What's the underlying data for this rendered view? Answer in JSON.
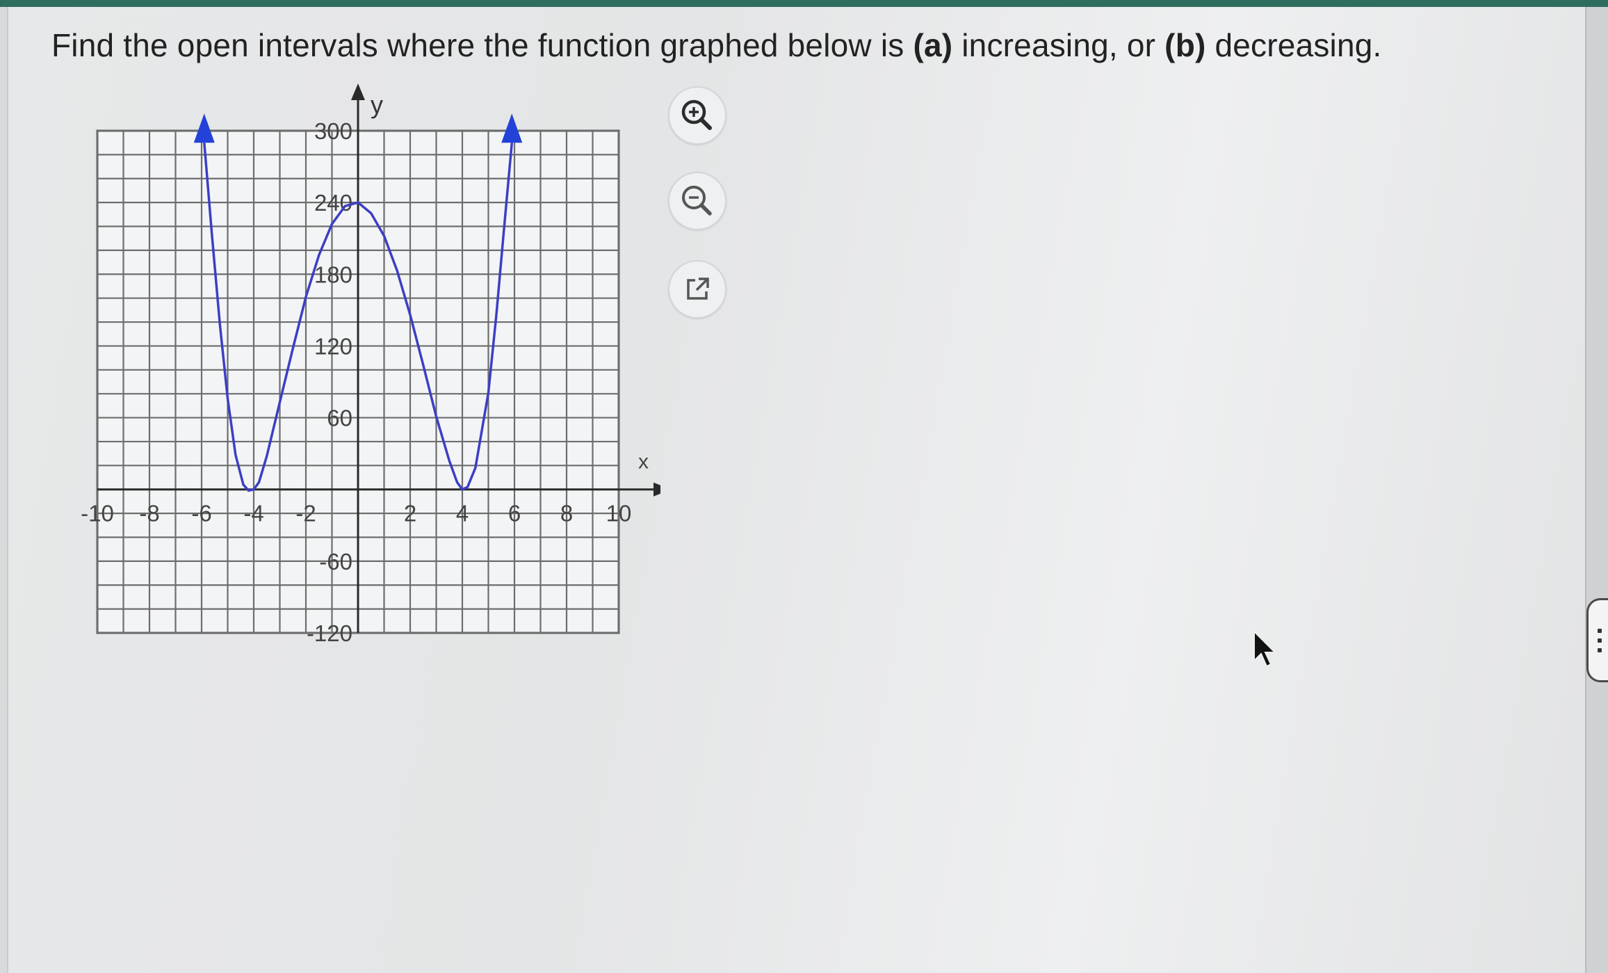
{
  "question": {
    "prefix": "Find the open intervals where the function graphed below is ",
    "part_a": "(a)",
    "mid": " increasing, or ",
    "part_b": "(b)",
    "suffix": " decreasing."
  },
  "toolbar": {
    "zoom_in_icon": "zoom-in-icon",
    "zoom_out_icon": "zoom-out-icon",
    "popout_icon": "external-link-icon"
  },
  "chart_data": {
    "type": "line",
    "xlabel": "x",
    "ylabel": "y",
    "xlim": [
      -10,
      10
    ],
    "ylim": [
      -120,
      300
    ],
    "grid": true,
    "x_ticks": [
      "-10",
      "-8",
      "-6",
      "-4",
      "-2",
      "2",
      "4",
      "6",
      "8",
      "10"
    ],
    "x_tick_values": [
      -10,
      -8,
      -6,
      -4,
      -2,
      2,
      4,
      6,
      8,
      10
    ],
    "y_ticks": [
      "300",
      "240",
      "180",
      "120",
      "60",
      "-60",
      "-120"
    ],
    "y_tick_values": [
      300,
      240,
      180,
      120,
      60,
      -60,
      -120
    ],
    "series": [
      {
        "color": "#3b3fc4",
        "arrow_color": "#2342d8",
        "end_arrows": true,
        "points": [
          [
            -5.9,
            290
          ],
          [
            -5.6,
            212
          ],
          [
            -5.3,
            138
          ],
          [
            -5,
            76
          ],
          [
            -4.7,
            29
          ],
          [
            -4.4,
            4
          ],
          [
            -4.2,
            -1
          ],
          [
            -4,
            0
          ],
          [
            -3.8,
            6
          ],
          [
            -3.5,
            28
          ],
          [
            -3,
            73
          ],
          [
            -2.5,
            118
          ],
          [
            -2,
            161
          ],
          [
            -1.5,
            196
          ],
          [
            -1,
            222
          ],
          [
            -0.5,
            237
          ],
          [
            0,
            240
          ],
          [
            0.5,
            231
          ],
          [
            1,
            212
          ],
          [
            1.5,
            183
          ],
          [
            2,
            146
          ],
          [
            2.5,
            104
          ],
          [
            3,
            61
          ],
          [
            3.5,
            24
          ],
          [
            3.8,
            6
          ],
          [
            4,
            0
          ],
          [
            4.2,
            2
          ],
          [
            4.5,
            18
          ],
          [
            5,
            81
          ],
          [
            5.3,
            145
          ],
          [
            5.6,
            218
          ],
          [
            5.9,
            290
          ]
        ]
      }
    ]
  }
}
